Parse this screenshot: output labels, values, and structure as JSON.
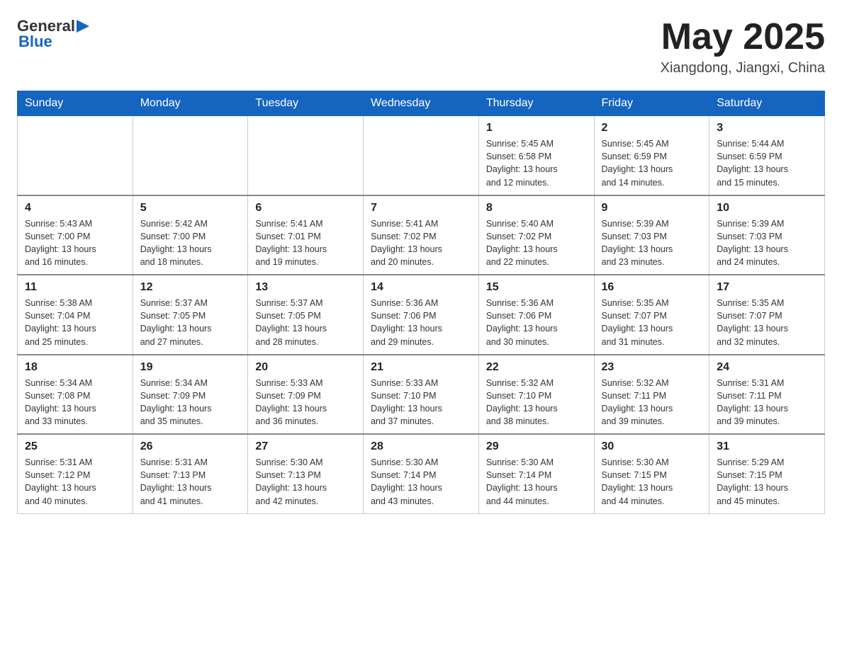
{
  "header": {
    "logo_general": "General",
    "logo_blue": "Blue",
    "month_title": "May 2025",
    "location": "Xiangdong, Jiangxi, China"
  },
  "days_of_week": [
    "Sunday",
    "Monday",
    "Tuesday",
    "Wednesday",
    "Thursday",
    "Friday",
    "Saturday"
  ],
  "weeks": [
    [
      {
        "day": "",
        "info": ""
      },
      {
        "day": "",
        "info": ""
      },
      {
        "day": "",
        "info": ""
      },
      {
        "day": "",
        "info": ""
      },
      {
        "day": "1",
        "info": "Sunrise: 5:45 AM\nSunset: 6:58 PM\nDaylight: 13 hours\nand 12 minutes."
      },
      {
        "day": "2",
        "info": "Sunrise: 5:45 AM\nSunset: 6:59 PM\nDaylight: 13 hours\nand 14 minutes."
      },
      {
        "day": "3",
        "info": "Sunrise: 5:44 AM\nSunset: 6:59 PM\nDaylight: 13 hours\nand 15 minutes."
      }
    ],
    [
      {
        "day": "4",
        "info": "Sunrise: 5:43 AM\nSunset: 7:00 PM\nDaylight: 13 hours\nand 16 minutes."
      },
      {
        "day": "5",
        "info": "Sunrise: 5:42 AM\nSunset: 7:00 PM\nDaylight: 13 hours\nand 18 minutes."
      },
      {
        "day": "6",
        "info": "Sunrise: 5:41 AM\nSunset: 7:01 PM\nDaylight: 13 hours\nand 19 minutes."
      },
      {
        "day": "7",
        "info": "Sunrise: 5:41 AM\nSunset: 7:02 PM\nDaylight: 13 hours\nand 20 minutes."
      },
      {
        "day": "8",
        "info": "Sunrise: 5:40 AM\nSunset: 7:02 PM\nDaylight: 13 hours\nand 22 minutes."
      },
      {
        "day": "9",
        "info": "Sunrise: 5:39 AM\nSunset: 7:03 PM\nDaylight: 13 hours\nand 23 minutes."
      },
      {
        "day": "10",
        "info": "Sunrise: 5:39 AM\nSunset: 7:03 PM\nDaylight: 13 hours\nand 24 minutes."
      }
    ],
    [
      {
        "day": "11",
        "info": "Sunrise: 5:38 AM\nSunset: 7:04 PM\nDaylight: 13 hours\nand 25 minutes."
      },
      {
        "day": "12",
        "info": "Sunrise: 5:37 AM\nSunset: 7:05 PM\nDaylight: 13 hours\nand 27 minutes."
      },
      {
        "day": "13",
        "info": "Sunrise: 5:37 AM\nSunset: 7:05 PM\nDaylight: 13 hours\nand 28 minutes."
      },
      {
        "day": "14",
        "info": "Sunrise: 5:36 AM\nSunset: 7:06 PM\nDaylight: 13 hours\nand 29 minutes."
      },
      {
        "day": "15",
        "info": "Sunrise: 5:36 AM\nSunset: 7:06 PM\nDaylight: 13 hours\nand 30 minutes."
      },
      {
        "day": "16",
        "info": "Sunrise: 5:35 AM\nSunset: 7:07 PM\nDaylight: 13 hours\nand 31 minutes."
      },
      {
        "day": "17",
        "info": "Sunrise: 5:35 AM\nSunset: 7:07 PM\nDaylight: 13 hours\nand 32 minutes."
      }
    ],
    [
      {
        "day": "18",
        "info": "Sunrise: 5:34 AM\nSunset: 7:08 PM\nDaylight: 13 hours\nand 33 minutes."
      },
      {
        "day": "19",
        "info": "Sunrise: 5:34 AM\nSunset: 7:09 PM\nDaylight: 13 hours\nand 35 minutes."
      },
      {
        "day": "20",
        "info": "Sunrise: 5:33 AM\nSunset: 7:09 PM\nDaylight: 13 hours\nand 36 minutes."
      },
      {
        "day": "21",
        "info": "Sunrise: 5:33 AM\nSunset: 7:10 PM\nDaylight: 13 hours\nand 37 minutes."
      },
      {
        "day": "22",
        "info": "Sunrise: 5:32 AM\nSunset: 7:10 PM\nDaylight: 13 hours\nand 38 minutes."
      },
      {
        "day": "23",
        "info": "Sunrise: 5:32 AM\nSunset: 7:11 PM\nDaylight: 13 hours\nand 39 minutes."
      },
      {
        "day": "24",
        "info": "Sunrise: 5:31 AM\nSunset: 7:11 PM\nDaylight: 13 hours\nand 39 minutes."
      }
    ],
    [
      {
        "day": "25",
        "info": "Sunrise: 5:31 AM\nSunset: 7:12 PM\nDaylight: 13 hours\nand 40 minutes."
      },
      {
        "day": "26",
        "info": "Sunrise: 5:31 AM\nSunset: 7:13 PM\nDaylight: 13 hours\nand 41 minutes."
      },
      {
        "day": "27",
        "info": "Sunrise: 5:30 AM\nSunset: 7:13 PM\nDaylight: 13 hours\nand 42 minutes."
      },
      {
        "day": "28",
        "info": "Sunrise: 5:30 AM\nSunset: 7:14 PM\nDaylight: 13 hours\nand 43 minutes."
      },
      {
        "day": "29",
        "info": "Sunrise: 5:30 AM\nSunset: 7:14 PM\nDaylight: 13 hours\nand 44 minutes."
      },
      {
        "day": "30",
        "info": "Sunrise: 5:30 AM\nSunset: 7:15 PM\nDaylight: 13 hours\nand 44 minutes."
      },
      {
        "day": "31",
        "info": "Sunrise: 5:29 AM\nSunset: 7:15 PM\nDaylight: 13 hours\nand 45 minutes."
      }
    ]
  ]
}
